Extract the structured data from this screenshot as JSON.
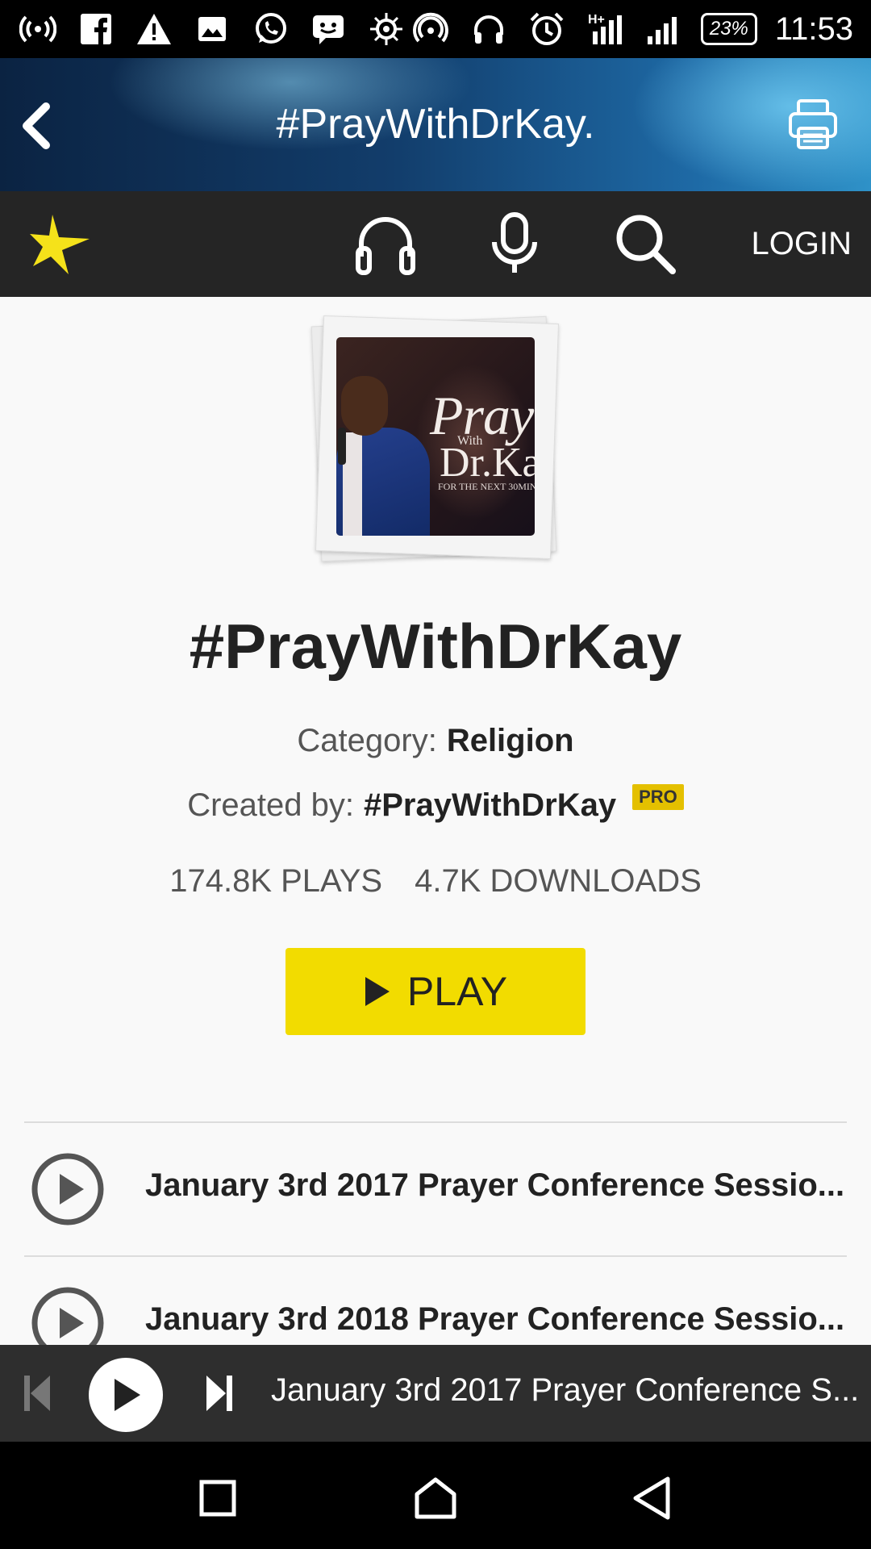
{
  "status_bar": {
    "time": "11:53",
    "battery": "23%",
    "icons_left": [
      "hotspot-icon",
      "facebook-icon",
      "warning-icon",
      "image-icon",
      "whatsapp-icon",
      "messenger-icon",
      "settings-wheel-icon"
    ],
    "icons_right": [
      "cast-icon",
      "headset-icon",
      "alarm-icon",
      "network-hplus-icon",
      "signal-icon"
    ]
  },
  "header": {
    "title": "#PrayWithDrKay."
  },
  "toolbar": {
    "login_label": "LOGIN"
  },
  "channel": {
    "title": "#PrayWithDrKay",
    "category_label": "Category:",
    "category_value": "Religion",
    "created_by_label": "Created by:",
    "created_by_value": "#PrayWithDrKay",
    "badge": "PRO",
    "plays": "174.8K PLAYS",
    "downloads": "4.7K DOWNLOADS",
    "play_label": "PLAY",
    "cover": {
      "text_main": "Pray",
      "text_with": "With",
      "text_dr": "Dr.Ka",
      "text_sub": "FOR THE NEXT 30MIN"
    }
  },
  "episodes": [
    {
      "title": "January 3rd 2017 Prayer Conference Sessio..."
    },
    {
      "title": "January 3rd 2018 Prayer Conference Sessio..."
    }
  ],
  "mini_player": {
    "now_playing": "January 3rd 2017 Prayer Conference S..."
  },
  "colors": {
    "accent_yellow": "#f2dc00",
    "toolbar_bg": "#252525",
    "star": "#f5e21a",
    "pro_badge": "#e4c000"
  }
}
